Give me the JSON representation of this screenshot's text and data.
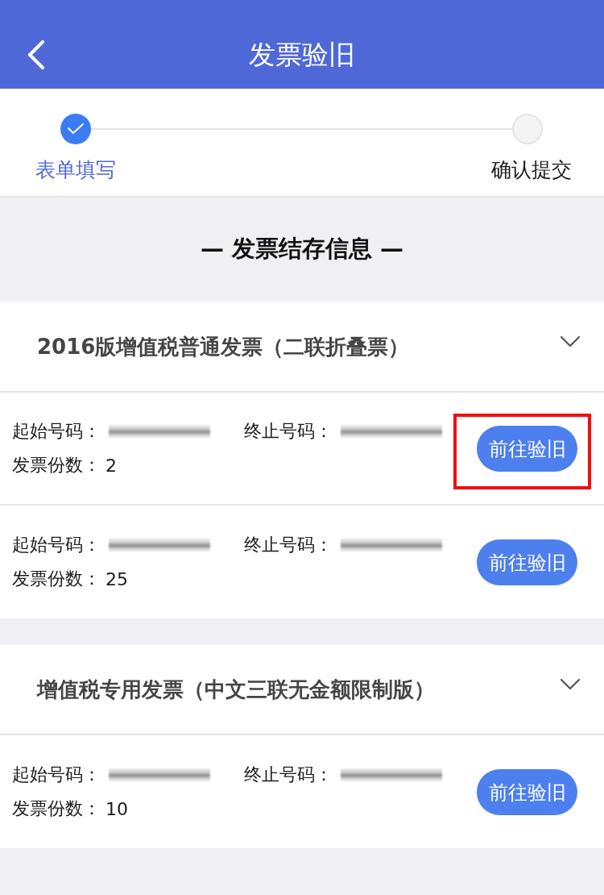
{
  "header": {
    "title": "发票验旧"
  },
  "steps": [
    {
      "label": "表单填写",
      "completed": true
    },
    {
      "label": "确认提交",
      "completed": false
    }
  ],
  "section_heading": "— 发票结存信息 —",
  "sections": [
    {
      "title": "2016版增值税普通发票（二联折叠票）",
      "expanded": true,
      "records": [
        {
          "start_label": "起始号码：",
          "end_label": "终止号码：",
          "count_label": "发票份数：",
          "count": "2",
          "action": "前往验旧",
          "highlighted": true
        },
        {
          "start_label": "起始号码：",
          "end_label": "终止号码：",
          "count_label": "发票份数：",
          "count": "25",
          "action": "前往验旧",
          "highlighted": false
        }
      ]
    },
    {
      "title": "增值税专用发票（中文三联无金额限制版）",
      "expanded": true,
      "records": [
        {
          "start_label": "起始号码：",
          "end_label": "终止号码：",
          "count_label": "发票份数：",
          "count": "10",
          "action": "前往验旧",
          "highlighted": false
        }
      ]
    }
  ]
}
